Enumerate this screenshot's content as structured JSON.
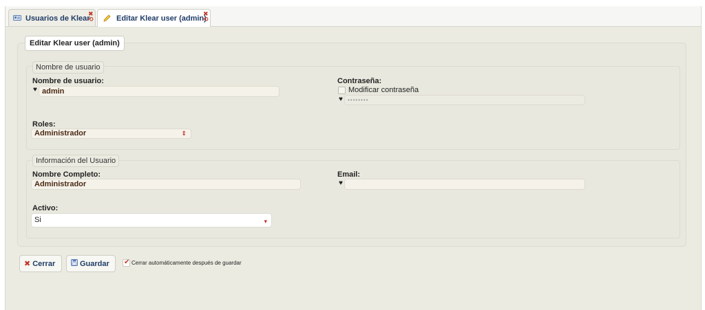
{
  "tabs": [
    {
      "label": "Usuarios de Klear",
      "icon": "user-list-icon"
    },
    {
      "label": "Editar Klear user (admin)",
      "icon": "pencil-icon"
    }
  ],
  "form": {
    "legend": "Editar Klear user (admin)",
    "sections": {
      "user": {
        "legend": "Nombre de usuario",
        "username_label": "Nombre de usuario:",
        "username_value": "admin",
        "password_label": "Contraseña:",
        "modify_password_label": "Modificar contraseña",
        "password_value": "••••••••",
        "roles_label": "Roles:",
        "roles_value": "Administrador"
      },
      "info": {
        "legend": "Información del Usuario",
        "fullname_label": "Nombre Completo:",
        "fullname_value": "Administrador",
        "email_label": "Email:",
        "email_value": "",
        "active_label": "Activo:",
        "active_value": "Si"
      }
    }
  },
  "actions": {
    "close_label": "Cerrar",
    "save_label": "Guardar",
    "autoclose_label": "Cerrar automáticamente después de guardar"
  },
  "colors": {
    "accent": "#1f3c66",
    "close_red": "#c0392b",
    "panel_bg": "#ecebe2"
  }
}
